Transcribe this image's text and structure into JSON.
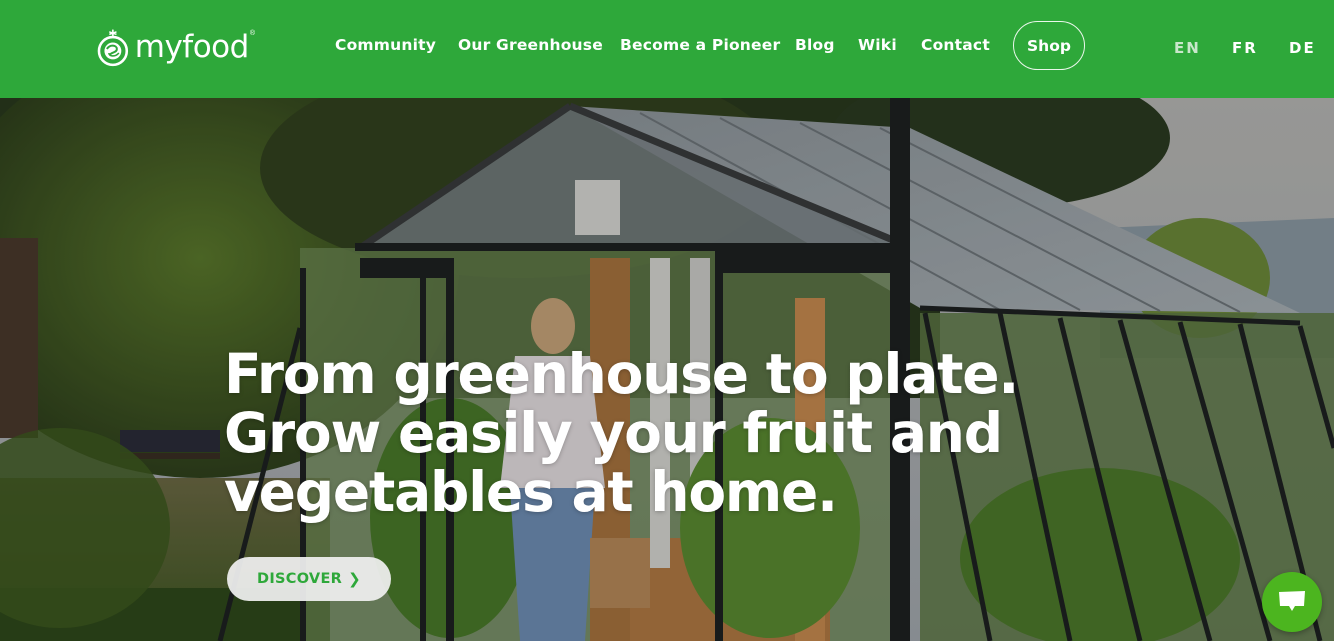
{
  "brand": {
    "name": "myfood",
    "registered_mark": "®",
    "logo_icon": "apple-leaf-logo-icon",
    "primary_color": "#2ea83a"
  },
  "nav": {
    "items": [
      {
        "label": "Community"
      },
      {
        "label": "Our Greenhouse"
      },
      {
        "label": "Become a Pioneer"
      },
      {
        "label": "Blog"
      },
      {
        "label": "Wiki"
      },
      {
        "label": "Contact"
      }
    ],
    "shop_label": "Shop",
    "languages": [
      {
        "code": "EN",
        "active": true
      },
      {
        "code": "FR",
        "active": false
      },
      {
        "code": "DE",
        "active": false
      }
    ]
  },
  "hero": {
    "headline_lines": [
      "From greenhouse to plate.",
      "Grow easily your fruit and",
      "vegetables at home."
    ],
    "cta_label": "DISCOVER",
    "cta_icon": "chevron-right-icon",
    "background_description": "Woman walking out of a glass greenhouse holding a basket, surrounded by trees and plants"
  },
  "chat_widget": {
    "icon": "chat-bubble-icon",
    "color": "#4cb51f"
  }
}
